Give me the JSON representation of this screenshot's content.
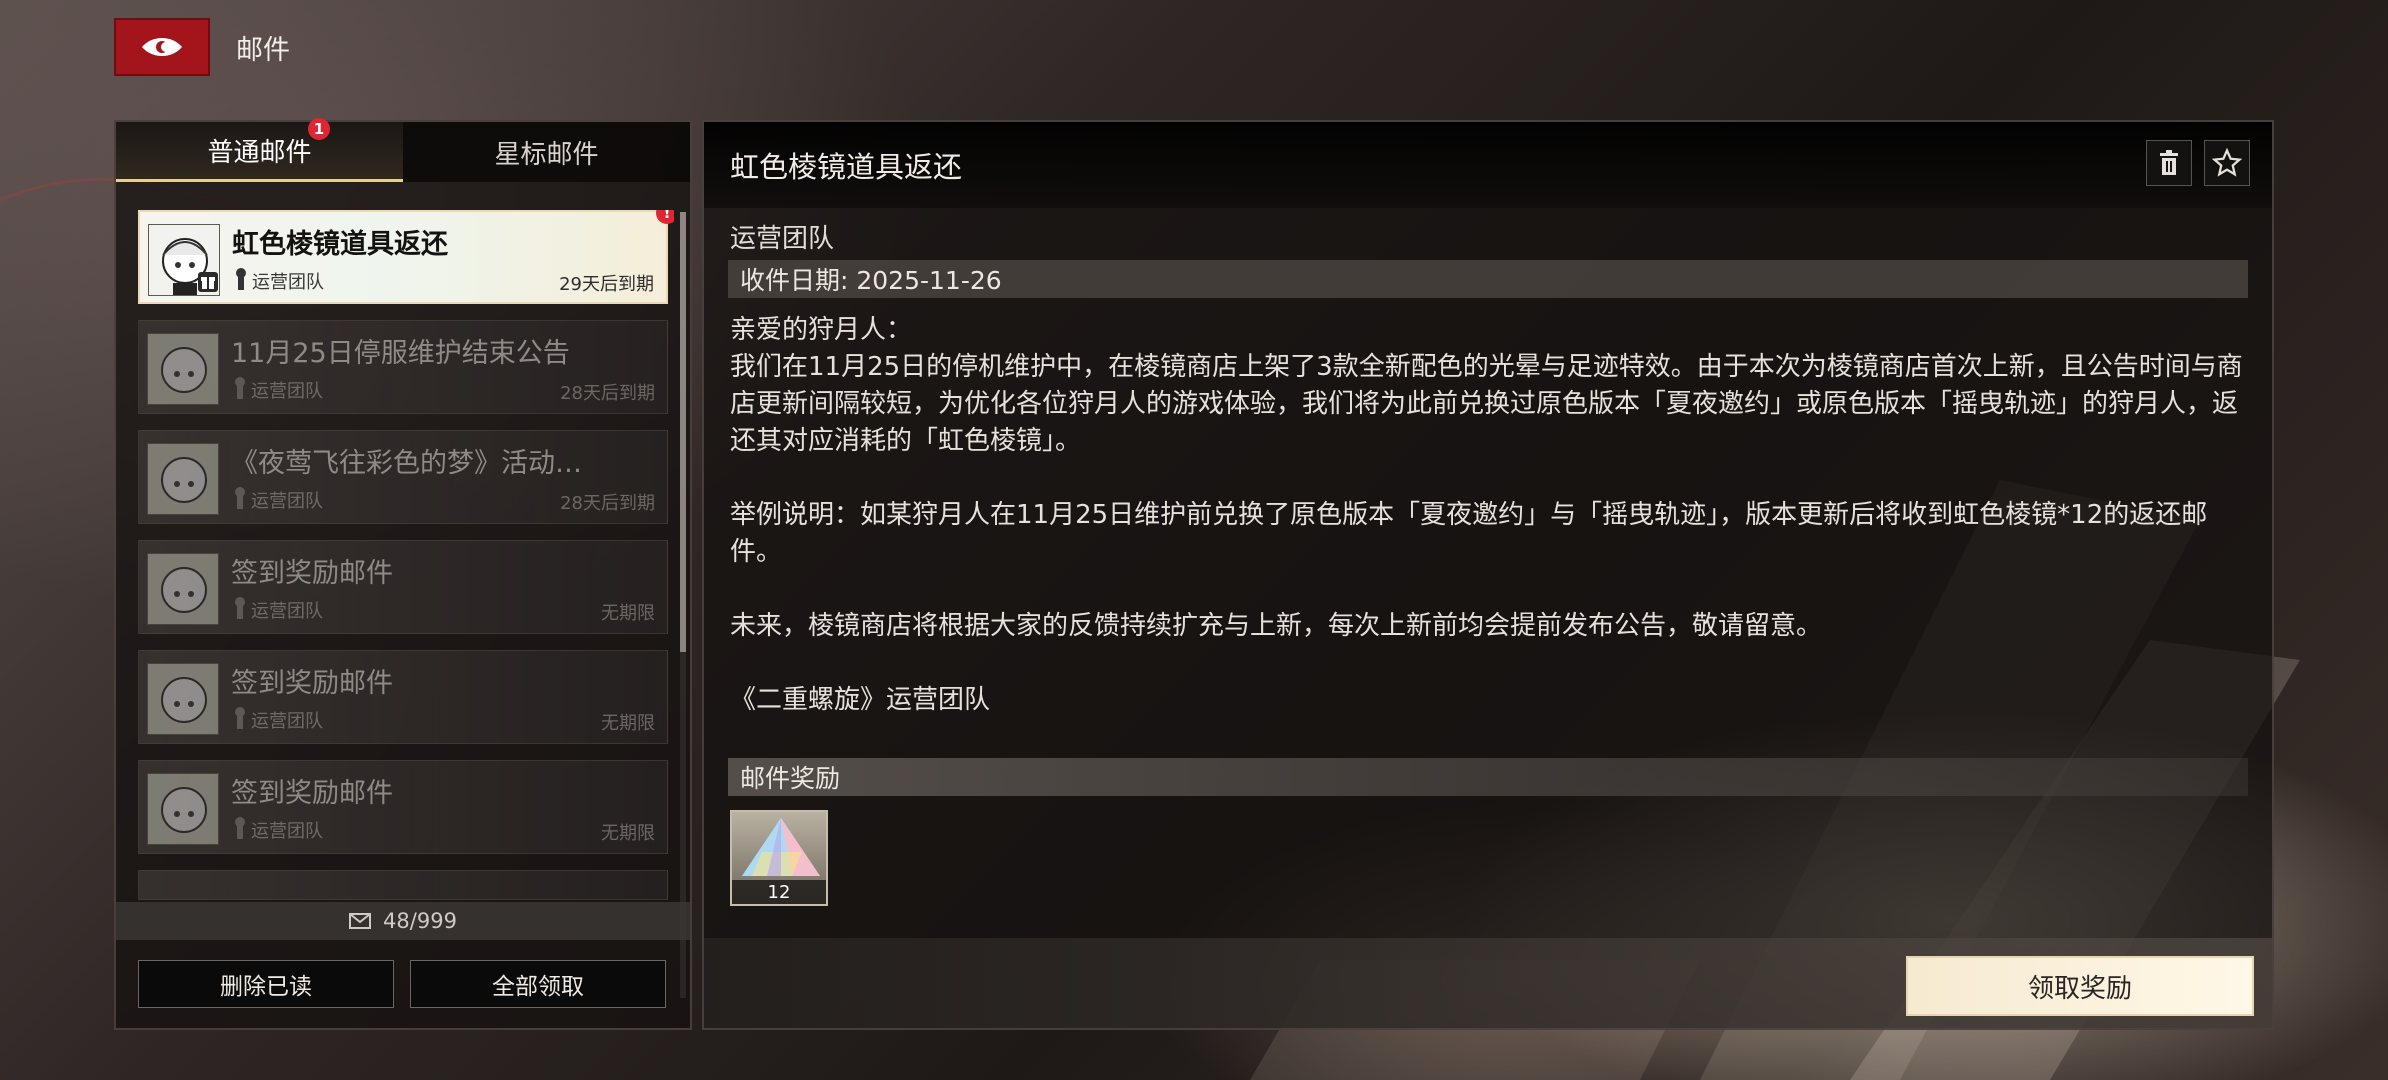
{
  "header": {
    "title": "邮件",
    "back_icon": "back-eye-icon"
  },
  "tabs": [
    {
      "label": "普通邮件",
      "badge": "1",
      "active": true
    },
    {
      "label": "星标邮件",
      "active": false
    }
  ],
  "mail_list": [
    {
      "title": "虹色棱镜道具返还",
      "sender": "运营团队",
      "expiry": "29天后到期",
      "selected": true,
      "badge": "!"
    },
    {
      "title": "11月25日停服维护结束公告",
      "sender": "运营团队",
      "expiry": "28天后到期"
    },
    {
      "title": "《夜莺飞往彩色的梦》活动…",
      "sender": "运营团队",
      "expiry": "28天后到期"
    },
    {
      "title": "签到奖励邮件",
      "sender": "运营团队",
      "expiry": "无期限"
    },
    {
      "title": "签到奖励邮件",
      "sender": "运营团队",
      "expiry": "无期限"
    },
    {
      "title": "签到奖励邮件",
      "sender": "运营团队",
      "expiry": "无期限"
    }
  ],
  "mail_count": "48/999",
  "left_buttons": {
    "delete_read": "删除已读",
    "claim_all": "全部领取"
  },
  "detail": {
    "title": "虹色棱镜道具返还",
    "sender": "运营团队",
    "date": "收件日期: 2025-11-26",
    "body": "亲爱的狩月人：\n我们在11月25日的停机维护中，在棱镜商店上架了3款全新配色的光晕与足迹特效。由于本次为棱镜商店首次上新，且公告时间与商店更新间隔较短，为优化各位狩月人的游戏体验，我们将为此前兑换过原色版本「夏夜邀约」或原色版本「摇曳轨迹」的狩月人，返还其对应消耗的「虹色棱镜」。\n\n举例说明：如某狩月人在11月25日维护前兑换了原色版本「夏夜邀约」与「摇曳轨迹」，版本更新后将收到虹色棱镜*12的返还邮件。\n\n未来，棱镜商店将根据大家的反馈持续扩充与上新，每次上新前均会提前发布公告，敬请留意。\n\n《二重螺旋》运营团队",
    "reward_label": "邮件奖励",
    "reward_count": "12",
    "claim_label": "领取奖励"
  }
}
